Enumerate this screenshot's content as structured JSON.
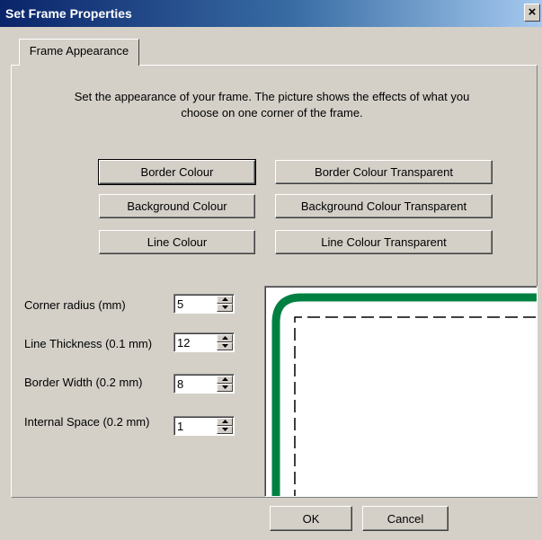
{
  "window": {
    "title": "Set Frame Properties",
    "close_label": "×"
  },
  "tabs": [
    {
      "label": "Frame Appearance"
    }
  ],
  "intro_text": "Set the appearance of your frame. The picture shows the effects of what you choose on one corner of the frame.",
  "colour_buttons": {
    "border_colour": "Border Colour",
    "border_colour_transparent": "Border Colour Transparent",
    "background_colour": "Background Colour",
    "background_colour_transparent": "Background Colour Transparent",
    "line_colour": "Line Colour",
    "line_colour_transparent": "Line Colour Transparent"
  },
  "fields": {
    "corner_radius": {
      "label": "Corner radius (mm)",
      "value": "5"
    },
    "line_thickness": {
      "label": "Line Thickness (0.1 mm)",
      "value": "12"
    },
    "border_width": {
      "label": "Border Width (0.2 mm)",
      "value": "8"
    },
    "internal_space": {
      "label": "Internal Space (0.2 mm)",
      "value": "1"
    }
  },
  "preview": {
    "line_colour": "#008040",
    "border_line_style": "dashed"
  },
  "footer": {
    "ok_label": "OK",
    "cancel_label": "Cancel"
  },
  "colors": {
    "dialog_bg": "#d4d0c8",
    "title_bar": "#0a246a"
  }
}
